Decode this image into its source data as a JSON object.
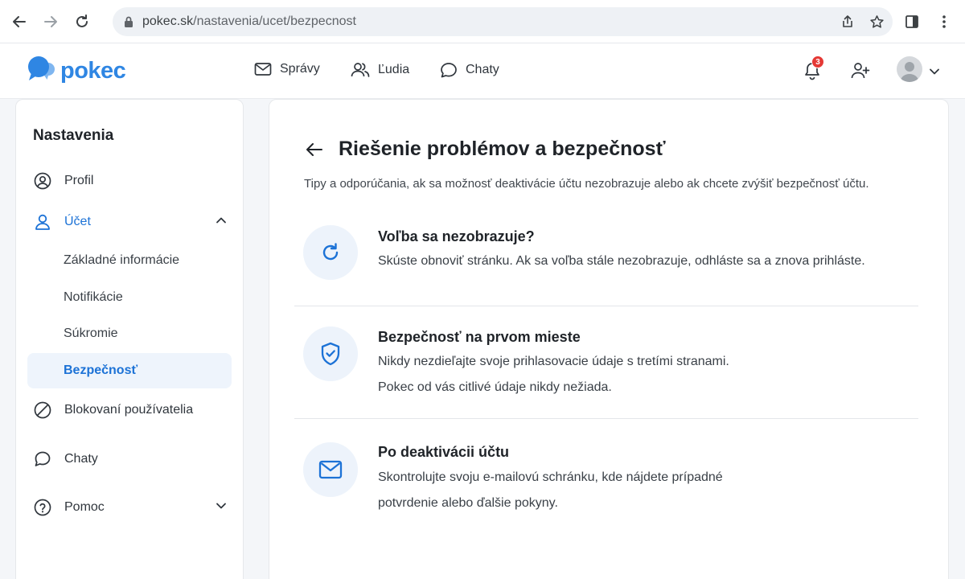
{
  "browser": {
    "url_host": "pokec.sk",
    "url_path": "/nastavenia/ucet/bezpecnost"
  },
  "header": {
    "logo_text": "pokec",
    "nav": [
      {
        "label": "Správy",
        "icon": "mail-icon"
      },
      {
        "label": "Ľudia",
        "icon": "people-icon"
      },
      {
        "label": "Chaty",
        "icon": "chat-bubble-icon"
      }
    ],
    "notification_count": "3"
  },
  "sidebar": {
    "title": "Nastavenia",
    "items": [
      {
        "label": "Profil",
        "icon": "user-circle-icon"
      },
      {
        "label": "Účet",
        "icon": "user-icon",
        "expanded": true
      },
      {
        "label": "Blokovaní používatelia",
        "icon": "block-icon"
      },
      {
        "label": "Chaty",
        "icon": "chat-bubble-icon"
      },
      {
        "label": "Pomoc",
        "icon": "help-circle-icon",
        "expanded": false
      }
    ],
    "account_sub": [
      {
        "label": "Základné informácie"
      },
      {
        "label": "Notifikácie"
      },
      {
        "label": "Súkromie"
      },
      {
        "label": "Bezpečnosť",
        "selected": true
      }
    ]
  },
  "main": {
    "title": "Riešenie problémov a bezpečnosť",
    "subtitle": "Tipy a odporúčania, ak sa možnosť deaktivácie účtu nezobrazuje alebo ak chcete zvýšiť bezpečnosť účtu.",
    "tips": [
      {
        "icon": "refresh-icon",
        "title": "Voľba sa nezobrazuje?",
        "lines": [
          "Skúste obnoviť stránku. Ak sa voľba stále nezobrazuje, odhláste sa a znova prihláste."
        ]
      },
      {
        "icon": "shield-check-icon",
        "title": "Bezpečnosť na prvom mieste",
        "lines": [
          "Nikdy nezdieľajte svoje prihlasovacie údaje s tretími stranami.",
          "Pokec od vás citlivé údaje nikdy nežiada."
        ]
      },
      {
        "icon": "mail-icon",
        "title": "Po deaktivácii účtu",
        "lines": [
          "Skontrolujte svoju e-mailovú schránku, kde nájdete prípadné",
          "potvrdenie alebo ďalšie pokyny."
        ]
      }
    ]
  },
  "colors": {
    "accent": "#1c72d6",
    "brand": "#2f86e3",
    "badge": "#e53935",
    "icon_circle": "#edf3fb"
  }
}
